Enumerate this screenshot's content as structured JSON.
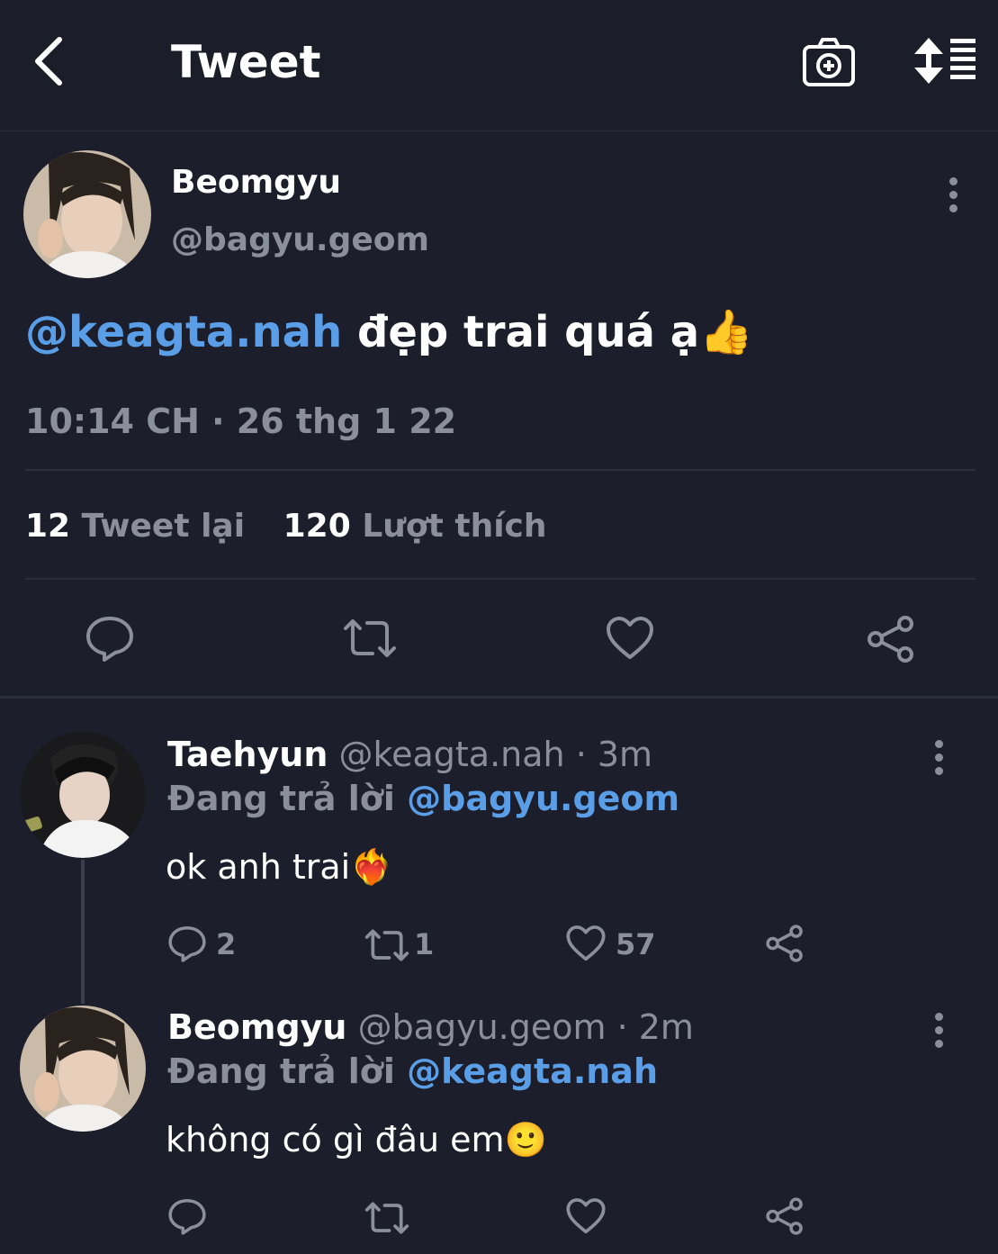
{
  "header": {
    "title": "Tweet"
  },
  "main_tweet": {
    "name": "Beomgyu",
    "handle": "@bagyu.geom",
    "mention": "@keagta.nah",
    "text": "đẹp trai quá ạ",
    "emoji": "👍",
    "timestamp": "10:14 CH · 26 thg 1 22",
    "retweet_count": "12",
    "retweet_label": "Tweet lại",
    "like_count": "120",
    "like_label": "Lượt thích"
  },
  "replies": [
    {
      "name": "Taehyun",
      "meta": "@keagta.nah · 3m",
      "replying_label": "Đang trả lời",
      "replying_to": "@bagyu.geom",
      "text": "ok anh trai",
      "emoji": "❤️‍🔥",
      "reply_count": "2",
      "retweet_count": "1",
      "like_count": "57"
    },
    {
      "name": "Beomgyu",
      "meta": "@bagyu.geom · 2m",
      "replying_label": "Đang trả lời",
      "replying_to": "@keagta.nah",
      "text": "không có gì đâu em",
      "emoji": "🙂"
    }
  ],
  "colors": {
    "background": "#1c1f2b",
    "accent": "#5b9ee8",
    "muted": "#8b8f9c"
  },
  "icons": [
    "back-icon",
    "camera-add-icon",
    "sort-icon",
    "more-icon",
    "reply-icon",
    "retweet-icon",
    "like-icon",
    "share-icon"
  ]
}
